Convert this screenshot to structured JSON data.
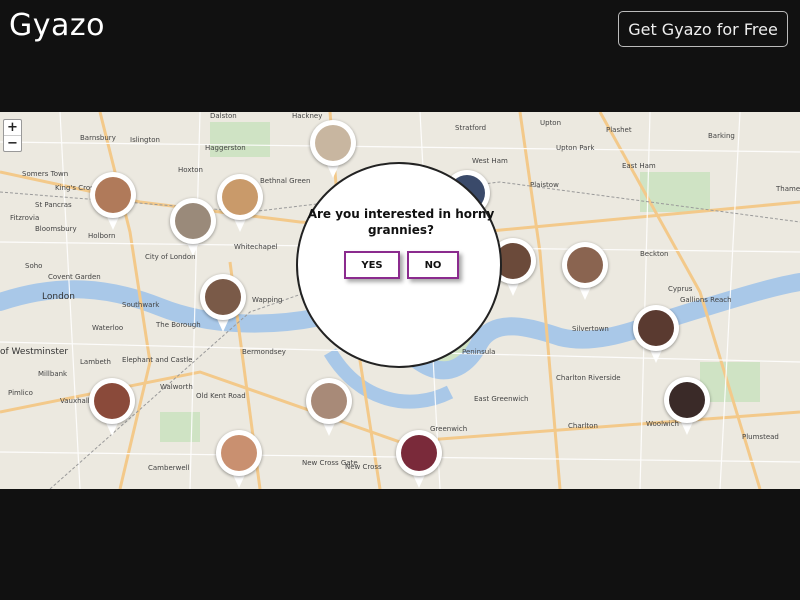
{
  "header": {
    "logo": "Gyazo",
    "cta_label": "Get Gyazo for Free"
  },
  "map": {
    "zoom_in": "+",
    "zoom_out": "−",
    "labels": [
      {
        "text": "Barnsbury"
      },
      {
        "text": "Islington"
      },
      {
        "text": "Dalston"
      },
      {
        "text": "Hackney"
      },
      {
        "text": "Stratford"
      },
      {
        "text": "Upton"
      },
      {
        "text": "Plashet"
      },
      {
        "text": "Barking"
      },
      {
        "text": "Somers Town"
      },
      {
        "text": "King's Cross"
      },
      {
        "text": "St Pancras"
      },
      {
        "text": "Hoxton"
      },
      {
        "text": "Haggerston"
      },
      {
        "text": "Bethnal Green"
      },
      {
        "text": "West Ham"
      },
      {
        "text": "Upton Park"
      },
      {
        "text": "East Ham"
      },
      {
        "text": "Fitzrovia"
      },
      {
        "text": "Bloomsbury"
      },
      {
        "text": "Holborn"
      },
      {
        "text": "Plaistow"
      },
      {
        "text": "Soho"
      },
      {
        "text": "City of London"
      },
      {
        "text": "Whitechapel"
      },
      {
        "text": "Beckton"
      },
      {
        "text": "Covent Garden"
      },
      {
        "text": "London"
      },
      {
        "text": "Southwark"
      },
      {
        "text": "Wapping"
      },
      {
        "text": "Cyprus"
      },
      {
        "text": "Gallions Reach"
      },
      {
        "text": "Waterloo"
      },
      {
        "text": "The Borough"
      },
      {
        "text": "Silvertown"
      },
      {
        "text": "of Westminster"
      },
      {
        "text": "Lambeth"
      },
      {
        "text": "Elephant and Castle"
      },
      {
        "text": "Bermondsey"
      },
      {
        "text": "Millbank"
      },
      {
        "text": "Walworth"
      },
      {
        "text": "Charlton Riverside"
      },
      {
        "text": "Pimlico"
      },
      {
        "text": "Vauxhall"
      },
      {
        "text": "Old Kent Road"
      },
      {
        "text": "East Greenwich"
      },
      {
        "text": "Charlton"
      },
      {
        "text": "Woolwich"
      },
      {
        "text": "Plumstead"
      },
      {
        "text": "Camberwell"
      },
      {
        "text": "New Cross Gate"
      },
      {
        "text": "New Cross"
      },
      {
        "text": "Greenwich"
      },
      {
        "text": "Peninsula"
      },
      {
        "text": "Thames"
      }
    ],
    "pins": [
      {
        "name": "pin-1",
        "color": "#b07a5a"
      },
      {
        "name": "pin-2",
        "color": "#c99a6a"
      },
      {
        "name": "pin-3",
        "color": "#9a8a7a"
      },
      {
        "name": "pin-4",
        "color": "#c8b6a0"
      },
      {
        "name": "pin-5",
        "color": "#7a5a48"
      },
      {
        "name": "pin-6",
        "color": "#6b4a3a"
      },
      {
        "name": "pin-7",
        "color": "#8a6450"
      },
      {
        "name": "pin-8",
        "color": "#5a3a30"
      },
      {
        "name": "pin-9",
        "color": "#8a4a3a"
      },
      {
        "name": "pin-10",
        "color": "#a88a78"
      },
      {
        "name": "pin-11",
        "color": "#c99070"
      },
      {
        "name": "pin-12",
        "color": "#7a2a3a"
      },
      {
        "name": "pin-13",
        "color": "#3a2a28"
      },
      {
        "name": "pin-14",
        "color": "#3a4a6a"
      }
    ]
  },
  "popup": {
    "question": "Are you interested in horny grannies?",
    "yes_label": "YES",
    "no_label": "NO"
  },
  "colors": {
    "page_bg": "#111111",
    "map_bg": "#ece9e0",
    "river": "#a9c8e8",
    "button_border": "#8b2b8e"
  }
}
